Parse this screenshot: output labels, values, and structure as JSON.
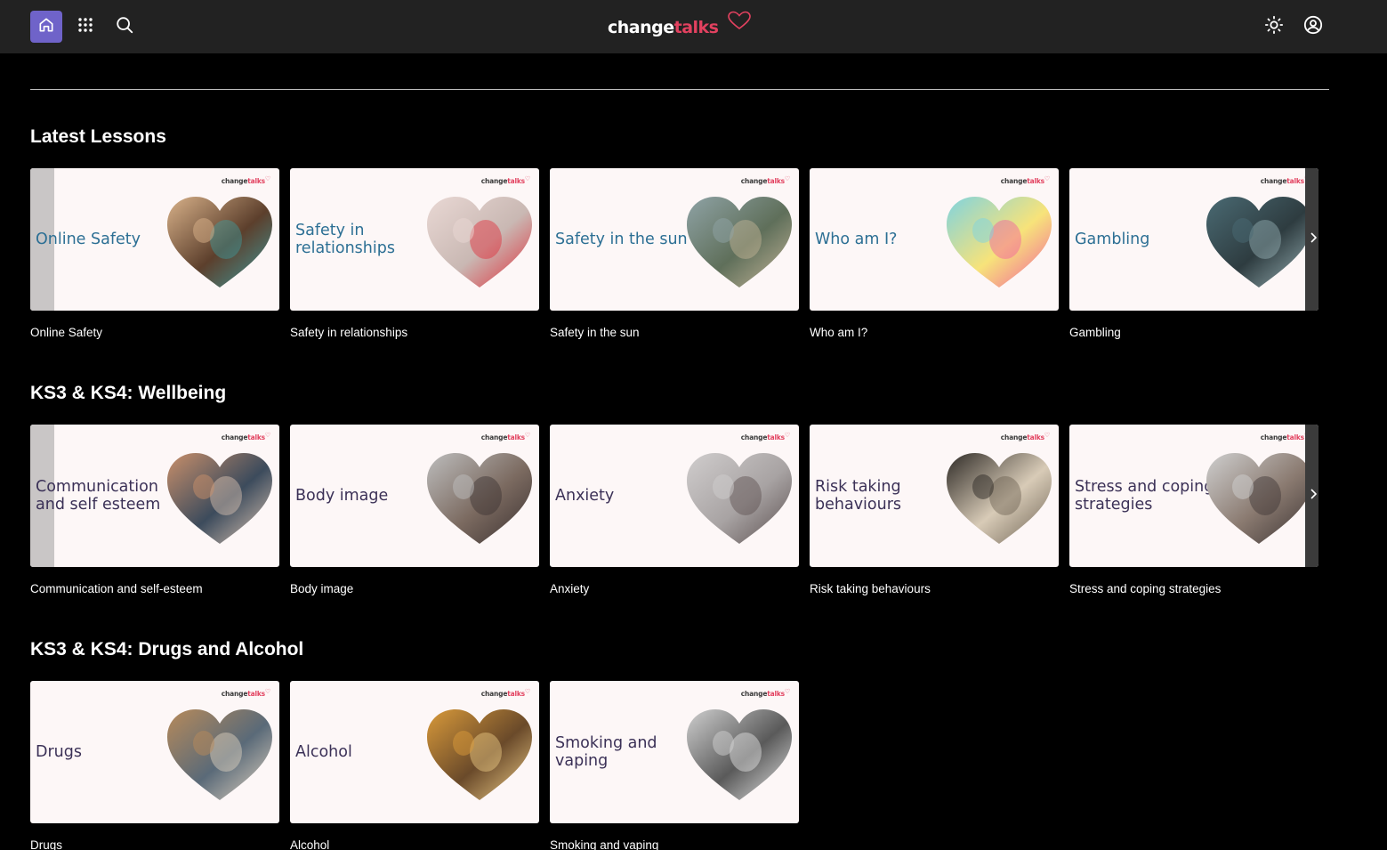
{
  "header": {
    "logo_part1": "change",
    "logo_part2": "talks",
    "icons": [
      "home-icon",
      "apps-grid-icon",
      "search-icon",
      "sun-icon",
      "account-icon"
    ],
    "accent_color": "#6f63c9",
    "brand_color": "#e2415f"
  },
  "card_logo": {
    "part1": "change",
    "part2": "talks"
  },
  "sections": [
    {
      "title": "Latest Lessons",
      "cards": [
        {
          "thumb_title": "Online Safety",
          "caption": "Online Safety",
          "thumb_color": "#2c6f94"
        },
        {
          "thumb_title": "Safety in relationships",
          "caption": "Safety in relationships",
          "thumb_color": "#2c6f94"
        },
        {
          "thumb_title": "Safety in the sun",
          "caption": "Safety in the sun",
          "thumb_color": "#2c6f94"
        },
        {
          "thumb_title": "Who am I?",
          "caption": "Who am I?",
          "thumb_color": "#2c6f94"
        },
        {
          "thumb_title": "Gambling",
          "caption": "Gambling",
          "thumb_color": "#2c6f94"
        }
      ]
    },
    {
      "title": "KS3 & KS4: Wellbeing",
      "cards": [
        {
          "thumb_title": "Communication and self esteem",
          "caption": "Communication and self-esteem",
          "thumb_color": "#3b3157"
        },
        {
          "thumb_title": "Body image",
          "caption": "Body image",
          "thumb_color": "#3b3157"
        },
        {
          "thumb_title": "Anxiety",
          "caption": "Anxiety",
          "thumb_color": "#3b3157"
        },
        {
          "thumb_title": "Risk taking behaviours",
          "caption": "Risk taking behaviours",
          "thumb_color": "#3b3157"
        },
        {
          "thumb_title": "Stress and coping strategies",
          "caption": "Stress and coping strategies",
          "thumb_color": "#3b3157"
        }
      ]
    },
    {
      "title": "KS3 & KS4: Drugs and Alcohol",
      "cards": [
        {
          "thumb_title": "Drugs",
          "caption": "Drugs",
          "thumb_color": "#3b3157"
        },
        {
          "thumb_title": "Alcohol",
          "caption": "Alcohol",
          "thumb_color": "#3b3157"
        },
        {
          "thumb_title": "Smoking and vaping",
          "caption": "Smoking and vaping",
          "thumb_color": "#3b3157"
        }
      ]
    }
  ]
}
